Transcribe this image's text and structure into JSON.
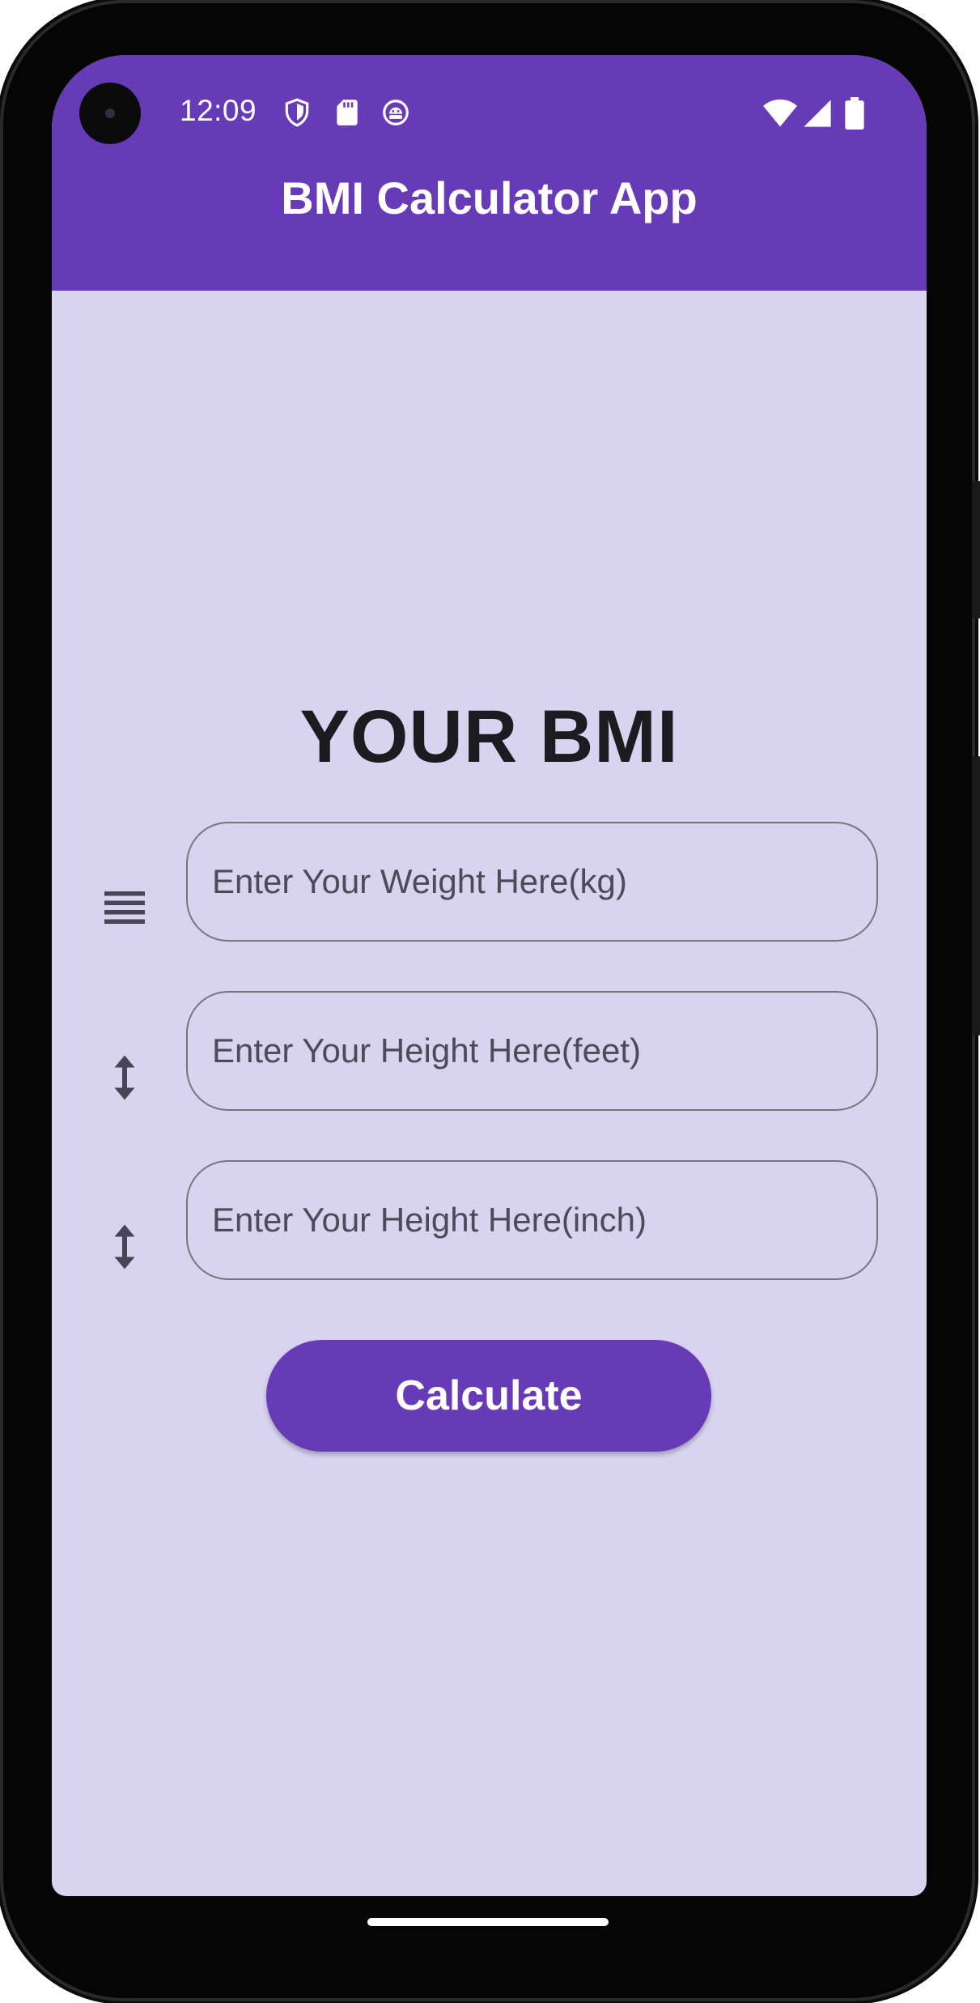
{
  "status_bar": {
    "time": "12:09",
    "icons": [
      "shield-icon",
      "sd-card-icon",
      "android-debug-icon",
      "wifi-icon",
      "signal-icon",
      "battery-icon"
    ]
  },
  "app_bar": {
    "title": "BMI Calculator App",
    "color": "#673ab7"
  },
  "main": {
    "heading": "YOUR BMI",
    "background": "#d8d3ef",
    "fields": [
      {
        "icon": "weight-lines-icon",
        "placeholder": "Enter Your Weight Here(kg)",
        "value": ""
      },
      {
        "icon": "height-arrow-icon",
        "placeholder": "Enter Your Height Here(feet)",
        "value": ""
      },
      {
        "icon": "height-arrow-icon",
        "placeholder": "Enter Your Height Here(inch)",
        "value": ""
      }
    ],
    "button_label": "Calculate"
  }
}
